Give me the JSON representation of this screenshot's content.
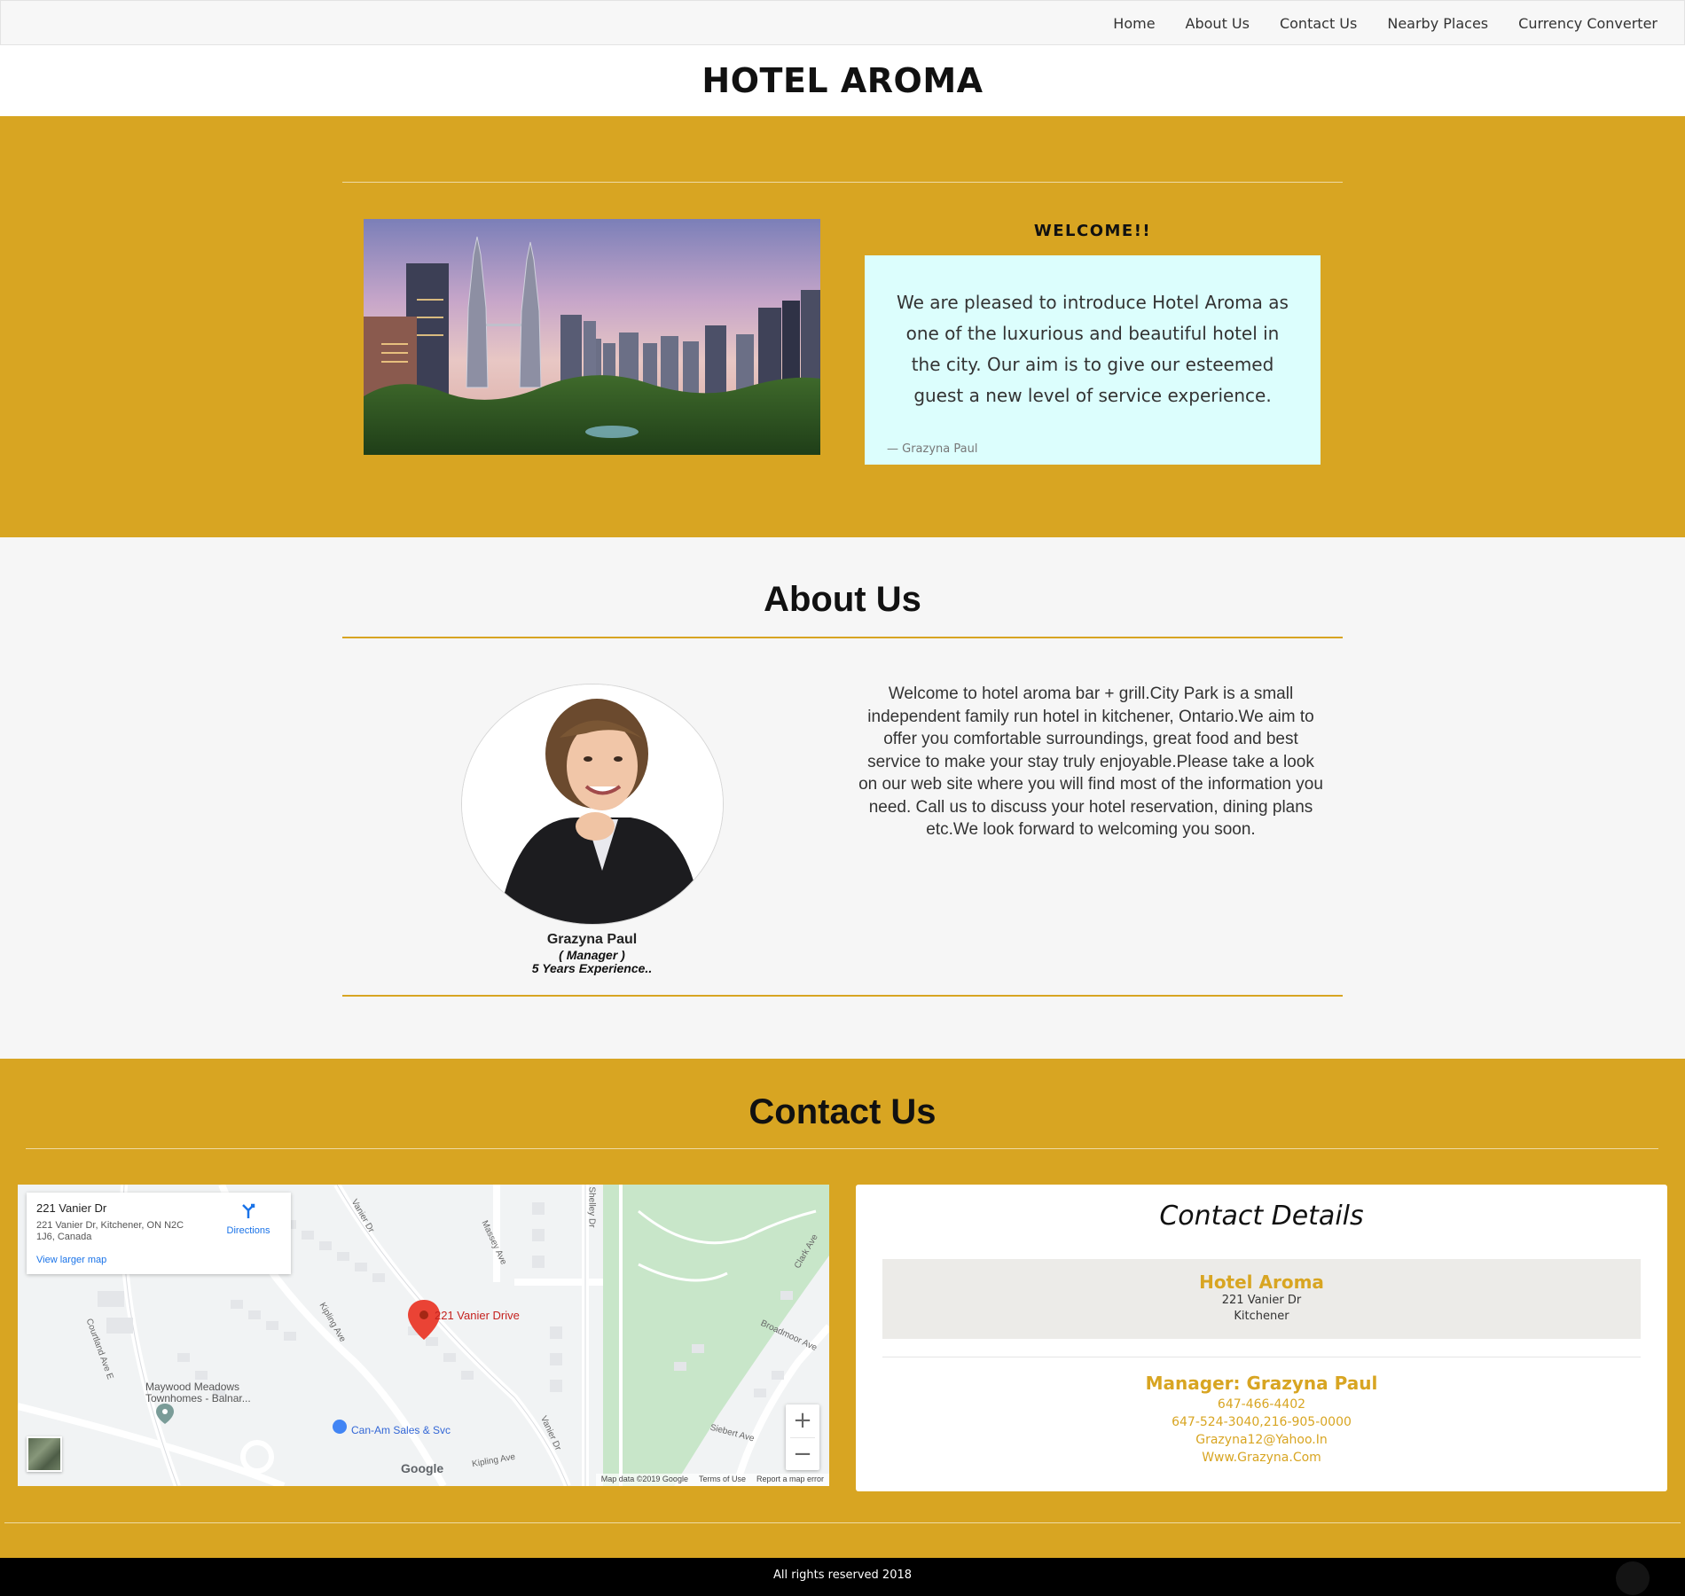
{
  "nav": {
    "items": [
      "Home",
      "About Us",
      "Contact Us",
      "Nearby Places",
      "Currency Converter"
    ]
  },
  "brand": {
    "title": "HOTEL AROMA"
  },
  "hero": {
    "welcome_title": "WELCOME!!",
    "welcome_text": "We are pleased to introduce Hotel Aroma as one of the luxurious and beautiful hotel in the city. Our aim is to give our esteemed guest a new level of service experience.",
    "welcome_sign": "—  Grazyna Paul"
  },
  "about": {
    "title": "About Us",
    "manager_name": "Grazyna Paul",
    "manager_role": "( Manager )",
    "manager_experience": "5 Years Experience..",
    "text": "Welcome to hotel aroma bar + grill.City Park is a small independent family run hotel in kitchener, Ontario.We aim to offer you comfortable surroundings, great food and best service to make your stay truly enjoyable.Please take a look on our web site where you will find most of the information you need. Call us to discuss your hotel reservation, dining plans etc.We look forward to welcoming you soon."
  },
  "contact": {
    "title": "Contact Us",
    "map": {
      "card_title": "221 Vanier Dr",
      "card_address": "221 Vanier Dr, Kitchener, ON N2C 1J6, Canada",
      "card_link": "View larger map",
      "directions_label": "Directions",
      "pin_label": "221 Vanier Drive",
      "poi_label": "Can-Am Sales & Svc",
      "area_label": "Maywood Meadows Townhomes - Balnar...",
      "streets": {
        "vanier_top": "Vanier Dr",
        "massey": "Massey Ave",
        "shelley": "Shelley Dr",
        "courtland": "Courtland Ave E",
        "kipling": "Kipling Ave",
        "kipling2": "Kipling Ave",
        "broadmoor": "Broadmoor Ave",
        "clark": "Clark Ave",
        "siebert": "Siebert Ave",
        "vanier_bottom": "Vanier Dr"
      },
      "zoom_in": "+",
      "zoom_out": "−",
      "google": "Google",
      "footer_data": "Map data ©2019 Google",
      "footer_terms": "Terms of Use",
      "footer_report": "Report a map error"
    },
    "details": {
      "title": "Contact Details",
      "hotel_name": "Hotel Aroma",
      "hotel_street": "221 Vanier Dr",
      "hotel_city": "Kitchener",
      "manager_heading": "Manager: Grazyna Paul",
      "phone1": "647-466-4402",
      "phone2": "647-524-3040,216-905-0000",
      "email": "Grazyna12@Yahoo.In",
      "website": "Www.Grazyna.Com"
    }
  },
  "footer": {
    "text": "All rights reserved 2018"
  },
  "colors": {
    "accent": "#d8a522",
    "welcome_box": "#dcfefd",
    "navbar": "#f7f7f7",
    "footer": "#000000"
  }
}
